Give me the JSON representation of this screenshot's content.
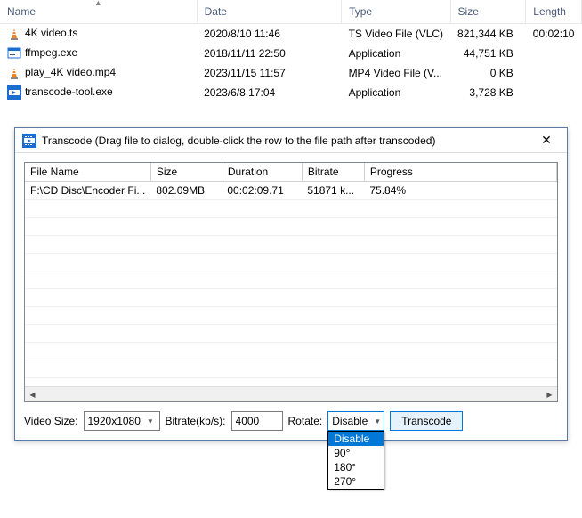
{
  "explorer": {
    "columns": [
      "Name",
      "Date",
      "Type",
      "Size",
      "Length"
    ],
    "rows": [
      {
        "icon": "vlc",
        "name": "4K video.ts",
        "date": "2020/8/10 11:46",
        "type": "TS Video File (VLC)",
        "size": "821,344 KB",
        "length": "00:02:10"
      },
      {
        "icon": "exe",
        "name": "ffmpeg.exe",
        "date": "2018/11/11 22:50",
        "type": "Application",
        "size": "44,751 KB",
        "length": ""
      },
      {
        "icon": "vlc",
        "name": "play_4K video.mp4",
        "date": "2023/11/15 11:57",
        "type": "MP4 Video File (V...",
        "size": "0 KB",
        "length": ""
      },
      {
        "icon": "film",
        "name": "transcode-tool.exe",
        "date": "2023/6/8 17:04",
        "type": "Application",
        "size": "3,728 KB",
        "length": ""
      }
    ]
  },
  "dialog": {
    "title": "Transcode (Drag file to dialog, double-click the row to the file path after transcoded)",
    "columns": [
      "File Name",
      "Size",
      "Duration",
      "Bitrate",
      "Progress"
    ],
    "rows": [
      {
        "filename": "F:\\CD Disc\\Encoder Fi...",
        "size": "802.09MB",
        "duration": "00:02:09.71",
        "bitrate": "51871 k...",
        "progress": "75.84%"
      }
    ],
    "controls": {
      "videoSizeLabel": "Video Size:",
      "videoSize": "1920x1080",
      "bitrateLabel": "Bitrate(kb/s):",
      "bitrate": "4000",
      "rotateLabel": "Rotate:",
      "rotate": "Disable",
      "rotateOptions": [
        "Disable",
        "90°",
        "180°",
        "270°"
      ],
      "transcodeButton": "Transcode"
    }
  }
}
